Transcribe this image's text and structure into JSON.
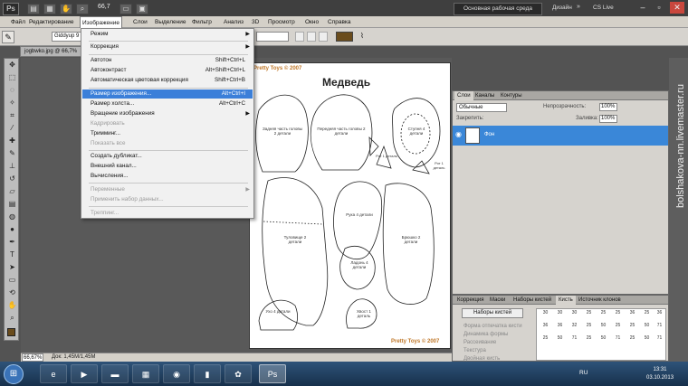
{
  "app": {
    "logo": "Ps",
    "zoom": "66,7"
  },
  "titlebar": {
    "workspace": "Основная рабочая среда",
    "design": "Дизайн",
    "more": "»",
    "cslive": "CS Live"
  },
  "menubar": [
    "Файл",
    "Редактирование",
    "Изображение",
    "Слои",
    "Выделение",
    "Фильтр",
    "Анализ",
    "3D",
    "Просмотр",
    "Окно",
    "Справка"
  ],
  "options": {
    "preset": "Giddyup 9"
  },
  "document": {
    "tab": "jogbwko.jpg @ 66,7%",
    "brand_top": "Pretty Toys © 2007",
    "title": "Медведь",
    "brand_bottom": "Pretty Toys © 2007",
    "parts": {
      "head_back": "Задняя часть головы 2 детали",
      "head_front": "Передняя часть головы 2 детали",
      "foot": "Ступня 4 детали",
      "mouth": "Рот 1 деталь",
      "ear": "Ухо 4 детали",
      "body": "Туловище 2 детали",
      "hand": "Рука 4 детали",
      "belly": "Брюшко 2 детали",
      "palm": "Ладонь 4 детали",
      "tail": "Хвост 1 деталь"
    }
  },
  "status": {
    "zoom": "66,67%",
    "doc_info": "Док: 1,45M/1,45M"
  },
  "image_menu": [
    {
      "label": "Режим",
      "shortcut": "",
      "submenu": true,
      "disabled": false
    },
    {
      "label": "Коррекция",
      "shortcut": "",
      "submenu": true,
      "disabled": false
    },
    {
      "label": "Автотон",
      "shortcut": "Shift+Ctrl+L",
      "submenu": false,
      "disabled": false
    },
    {
      "label": "Автоконтраст",
      "shortcut": "Alt+Shift+Ctrl+L",
      "submenu": false,
      "disabled": false
    },
    {
      "label": "Автоматическая цветовая коррекция",
      "shortcut": "Shift+Ctrl+B",
      "submenu": false,
      "disabled": false
    },
    {
      "label": "Размер изображения...",
      "shortcut": "Alt+Ctrl+I",
      "submenu": false,
      "disabled": false,
      "highlighted": true
    },
    {
      "label": "Размер холста...",
      "shortcut": "Alt+Ctrl+C",
      "submenu": false,
      "disabled": false
    },
    {
      "label": "Вращение изображения",
      "shortcut": "",
      "submenu": true,
      "disabled": false
    },
    {
      "label": "Кадрировать",
      "shortcut": "",
      "submenu": false,
      "disabled": true
    },
    {
      "label": "Тримминг...",
      "shortcut": "",
      "submenu": false,
      "disabled": false
    },
    {
      "label": "Показать все",
      "shortcut": "",
      "submenu": false,
      "disabled": true
    },
    {
      "label": "Создать дубликат...",
      "shortcut": "",
      "submenu": false,
      "disabled": false
    },
    {
      "label": "Внешний канал...",
      "shortcut": "",
      "submenu": false,
      "disabled": false
    },
    {
      "label": "Вычисления...",
      "shortcut": "",
      "submenu": false,
      "disabled": false
    },
    {
      "label": "Переменные",
      "shortcut": "",
      "submenu": true,
      "disabled": true
    },
    {
      "label": "Применить набор данных...",
      "shortcut": "",
      "submenu": false,
      "disabled": true
    },
    {
      "label": "Треппинг...",
      "shortcut": "",
      "submenu": false,
      "disabled": true
    }
  ],
  "layers_panel": {
    "tabs": [
      "Слои",
      "Каналы",
      "Контуры"
    ],
    "blend_mode": "Обычные",
    "opacity_label": "Непрозрачность:",
    "opacity": "100%",
    "lock_label": "Закрепить:",
    "fill_label": "Заливка:",
    "fill": "100%",
    "layer_name": "Фон"
  },
  "brush_panel": {
    "tabs": [
      "Коррекция",
      "Маски",
      "Наборы кистей",
      "Кисть",
      "Источник клонов"
    ],
    "presets_button": "Наборы кистей",
    "list": [
      "Форма отпечатка кисти",
      "Динамика формы",
      "Рассеивание",
      "Текстура",
      "Двойная кисть"
    ],
    "sizes": [
      "30",
      "30",
      "30",
      "25",
      "25",
      "25",
      "36",
      "25",
      "36",
      "36",
      "36",
      "32",
      "25",
      "50",
      "25",
      "25",
      "50",
      "71",
      "25",
      "50",
      "71",
      "25",
      "50",
      "71",
      "25",
      "50",
      "71"
    ]
  },
  "taskbar": {
    "lang": "RU",
    "time": "13:31",
    "date": "03.10.2013"
  },
  "watermark": "bolshakova-nn.livemaster.ru"
}
